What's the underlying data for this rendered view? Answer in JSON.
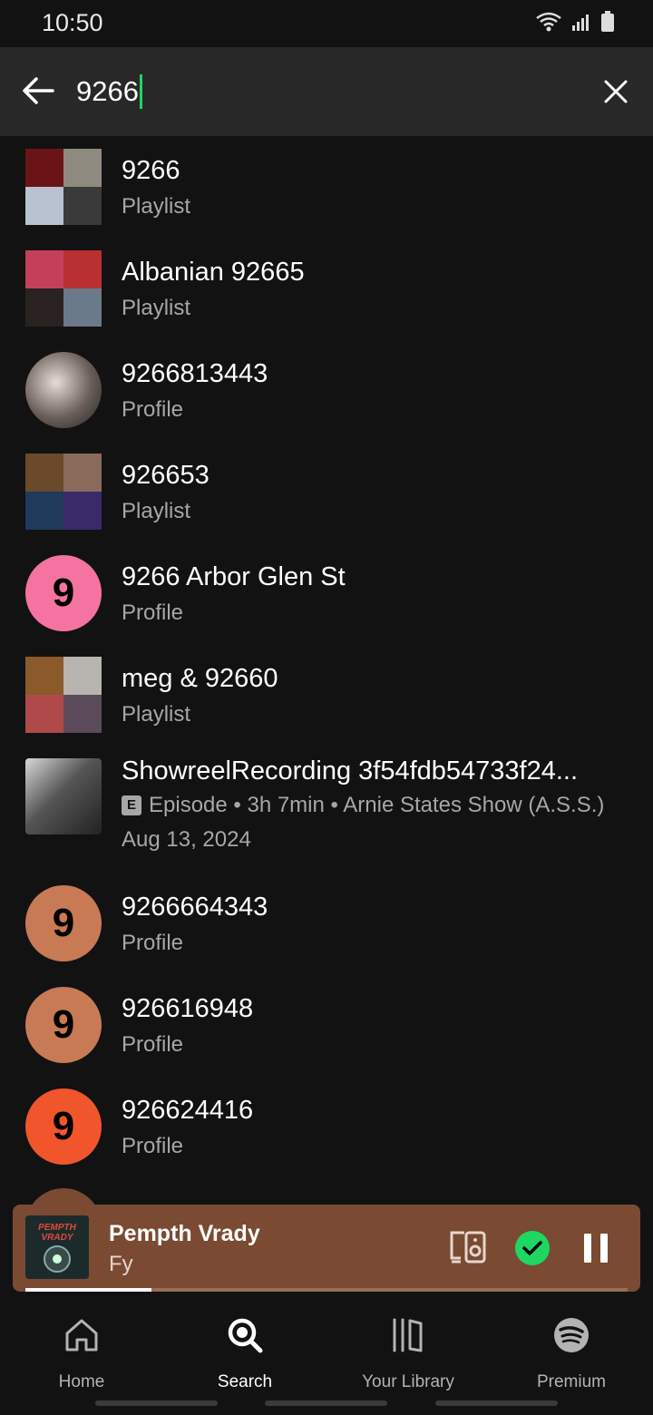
{
  "status": {
    "time": "10:50",
    "icons": [
      "wifi-icon",
      "signal-icon",
      "battery-icon"
    ]
  },
  "search": {
    "query": "9266",
    "back_icon": "arrow-left-icon",
    "clear_icon": "close-icon"
  },
  "results": [
    {
      "title": "9266",
      "subtitle": "Playlist",
      "kind": "mosaic"
    },
    {
      "title": "Albanian 92665",
      "subtitle": "Playlist",
      "kind": "mosaic"
    },
    {
      "title": "9266813443",
      "subtitle": "Profile",
      "kind": "photo"
    },
    {
      "title": "926653",
      "subtitle": "Playlist",
      "kind": "mosaic"
    },
    {
      "title": "9266 Arbor Glen St",
      "subtitle": "Profile",
      "kind": "letter",
      "letter": "9",
      "color": "#f573a0"
    },
    {
      "title": "meg & 92660",
      "subtitle": "Playlist",
      "kind": "mosaic"
    },
    {
      "title": "ShowreelRecording 3f54fdb54733f24...",
      "badge": "E",
      "subtitle": "Episode • 3h 7min • Arnie States Show (A.S.S.)",
      "date": "Aug 13, 2024",
      "kind": "photo"
    },
    {
      "title": "9266664343",
      "subtitle": "Profile",
      "kind": "letter",
      "letter": "9",
      "color": "#c87a55"
    },
    {
      "title": "926616948",
      "subtitle": "Profile",
      "kind": "letter",
      "letter": "9",
      "color": "#c87a55"
    },
    {
      "title": "926624416",
      "subtitle": "Profile",
      "kind": "letter",
      "letter": "9",
      "color": "#f0552b"
    }
  ],
  "now_playing": {
    "title": "Pempth Vrady",
    "artist": "Fy",
    "art_text": "PEMPTH VRADY",
    "progress": 0.21,
    "colors": {
      "background": "#7a4a33",
      "check": "#1ed760"
    }
  },
  "nav": [
    {
      "label": "Home",
      "icon": "home-icon",
      "active": false
    },
    {
      "label": "Search",
      "icon": "search-icon",
      "active": true
    },
    {
      "label": "Your Library",
      "icon": "library-icon",
      "active": false
    },
    {
      "label": "Premium",
      "icon": "spotify-logo-icon",
      "active": false
    }
  ]
}
